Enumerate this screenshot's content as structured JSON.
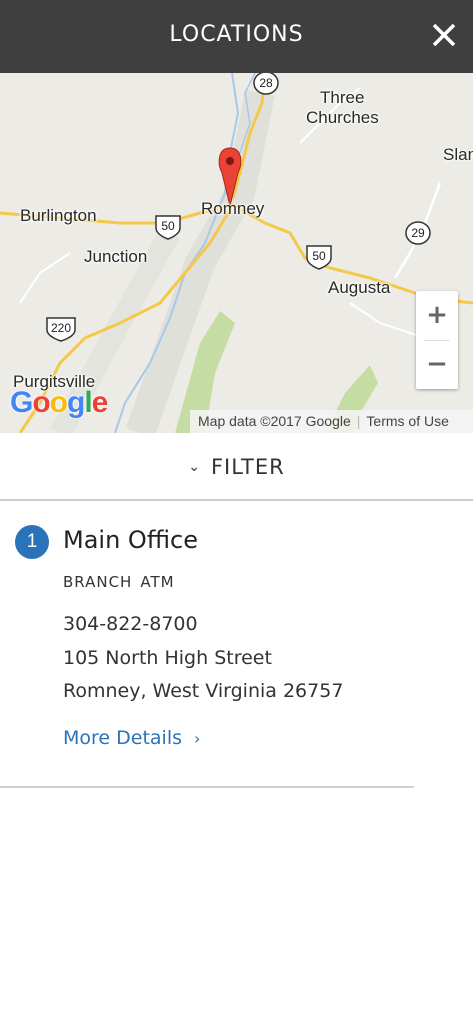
{
  "header": {
    "title": "LOCATIONS",
    "close_icon": "close-icon"
  },
  "map": {
    "place_labels": {
      "three_churches_1": "Three",
      "three_churches_2": "Churches",
      "slan": "Slan",
      "burlington": "Burlington",
      "romney": "Romney",
      "junction": "Junction",
      "augusta": "Augusta",
      "purgitsville": "Purgitsville"
    },
    "route_shields": {
      "r28": "28",
      "r50a": "50",
      "r50b": "50",
      "r29": "29",
      "r220": "220"
    },
    "zoom_in": "+",
    "zoom_out": "−",
    "attribution": "Map data ©2017 Google",
    "terms": "Terms of Use",
    "logo": "Google",
    "pin_color": "#ea4335"
  },
  "filter": {
    "label": "FILTER"
  },
  "location": {
    "number": "1",
    "name": "Main Office",
    "types": [
      "BRANCH",
      "ATM"
    ],
    "phone": "304-822-8700",
    "street": "105 North High Street",
    "city_state_zip": "Romney, West Virginia 26757",
    "more_label": "More Details",
    "accent_color": "#2a73b8"
  }
}
